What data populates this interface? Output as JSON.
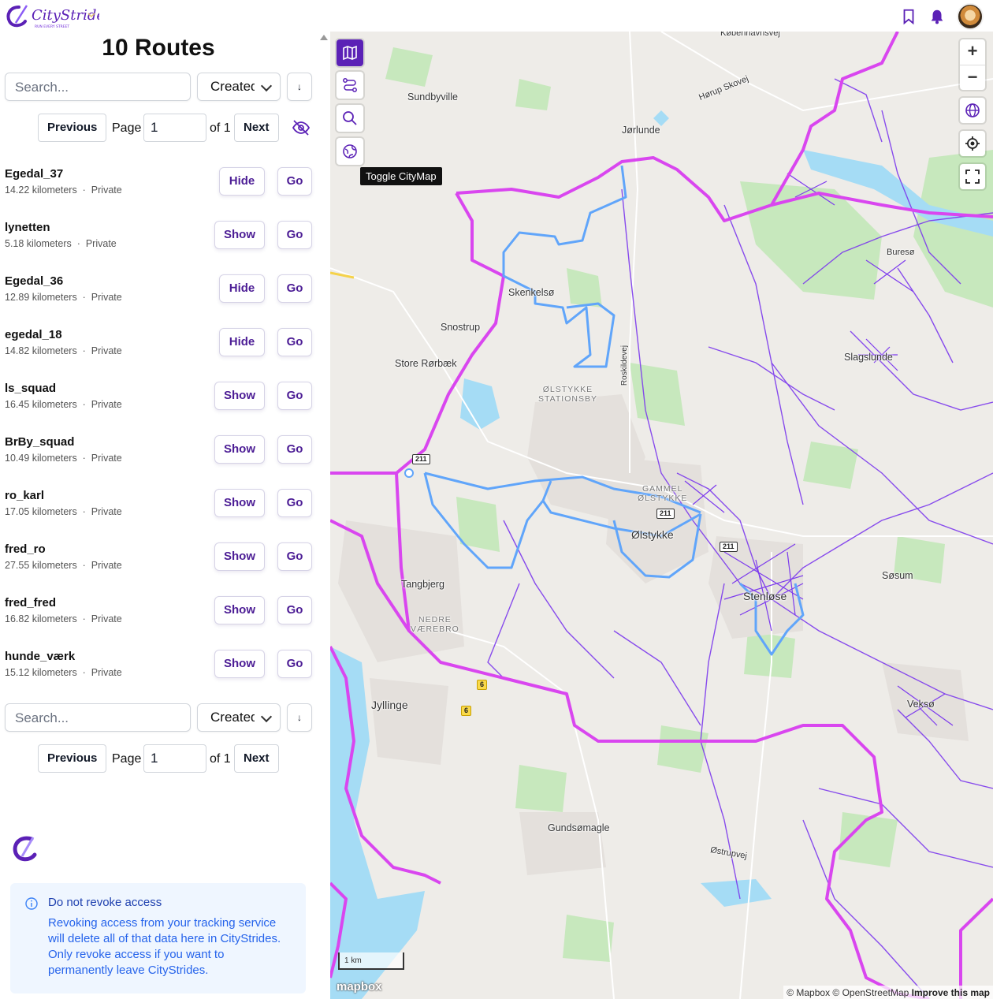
{
  "app": {
    "logo_text": "CityStrides",
    "logo_tagline": "RUN EVERY STREET"
  },
  "sidebar": {
    "title": "10 Routes",
    "search_placeholder": "Search...",
    "sort_value": "Created",
    "sort_direction_glyph": "↓",
    "pager": {
      "previous": "Previous",
      "page_label": "Page",
      "page_value": "1",
      "of_label": "of 1",
      "next": "Next"
    },
    "routes": [
      {
        "name": "Egedal_37",
        "distance": "14.22 kilometers",
        "visibility": "Private",
        "toggle": "Hide",
        "go": "Go"
      },
      {
        "name": "lynetten",
        "distance": "5.18 kilometers",
        "visibility": "Private",
        "toggle": "Show",
        "go": "Go"
      },
      {
        "name": "Egedal_36",
        "distance": "12.89 kilometers",
        "visibility": "Private",
        "toggle": "Hide",
        "go": "Go"
      },
      {
        "name": "egedal_18",
        "distance": "14.82 kilometers",
        "visibility": "Private",
        "toggle": "Hide",
        "go": "Go"
      },
      {
        "name": "ls_squad",
        "distance": "16.45 kilometers",
        "visibility": "Private",
        "toggle": "Show",
        "go": "Go"
      },
      {
        "name": "BrBy_squad",
        "distance": "10.49 kilometers",
        "visibility": "Private",
        "toggle": "Show",
        "go": "Go"
      },
      {
        "name": "ro_karl",
        "distance": "17.05 kilometers",
        "visibility": "Private",
        "toggle": "Show",
        "go": "Go"
      },
      {
        "name": "fred_ro",
        "distance": "27.55 kilometers",
        "visibility": "Private",
        "toggle": "Show",
        "go": "Go"
      },
      {
        "name": "fred_fred",
        "distance": "16.82 kilometers",
        "visibility": "Private",
        "toggle": "Show",
        "go": "Go"
      },
      {
        "name": "hunde_værk",
        "distance": "15.12 kilometers",
        "visibility": "Private",
        "toggle": "Show",
        "go": "Go"
      }
    ],
    "meta_separator": "·",
    "alert": {
      "heading": "Do not revoke access",
      "body": "Revoking access from your tracking service will delete all of that data here in CityStrides. Only revoke access if you want to permanently leave CityStrides."
    }
  },
  "map": {
    "tooltip": "Toggle CityMap",
    "zoom_in": "+",
    "zoom_out": "−",
    "places": {
      "kobenhavnsvej": "Københavnsvej",
      "sundbyvillle": "Sundbyville",
      "horup": "Hørup Skovej",
      "jorlunde": "Jørlunde",
      "skenkelso": "Skenkelsø",
      "snostrup": "Snostrup",
      "store_rorbaek": "Store Rørbæk",
      "olstykke_st_1": "ØLSTYKKE",
      "olstykke_st_2": "STATIONSBY",
      "roskildevej": "Roskildevej",
      "gammel_1": "GAMMEL",
      "gammel_2": "ØLSTYKKE",
      "olstykke": "Ølstykke",
      "tangbjerg": "Tangbjerg",
      "nedre_1": "NEDRE",
      "nedre_2": "VÆREBRO",
      "stenlose": "Stenløse",
      "jyllinge": "Jyllinge",
      "gundsomagle": "Gundsømagle",
      "ostrupvej": "Østrupvej",
      "buresø": "Buresø",
      "slagslunde": "Slagslunde",
      "sosum": "Søsum",
      "vekso": "Veksø"
    },
    "shields": {
      "r211": "211",
      "r6": "6"
    },
    "scale": "1 km",
    "mapbox_logo": "mapbox",
    "attribution": "© Mapbox © OpenStreetMap",
    "improve": "Improve this map"
  },
  "colors": {
    "brand": "#5b21b6",
    "city_boundary": "#d946ef",
    "route": "#60a5fa",
    "streets": "#7c3aed",
    "water": "#a5dcf5",
    "green": "#c7e8bd"
  }
}
